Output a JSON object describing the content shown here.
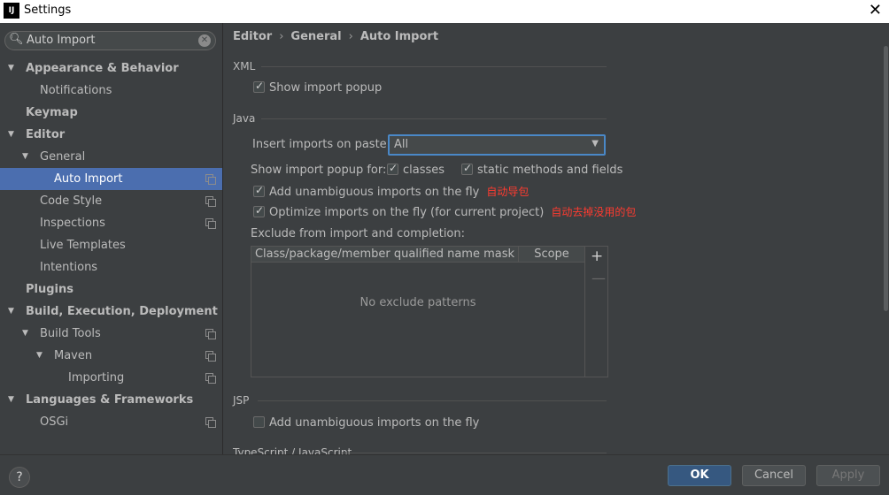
{
  "window": {
    "title": "Settings",
    "icon_text": "IJ",
    "close_icon": "close-icon"
  },
  "search": {
    "value": "Auto Import"
  },
  "tree": [
    {
      "label": "Appearance & Behavior",
      "level": 0,
      "bold": true,
      "expanded": true
    },
    {
      "label": "Notifications",
      "level": 1
    },
    {
      "label": "Keymap",
      "level": 0,
      "bold": true
    },
    {
      "label": "Editor",
      "level": 0,
      "bold": true,
      "expanded": true
    },
    {
      "label": "General",
      "level": 1,
      "expanded": true
    },
    {
      "label": "Auto Import",
      "level": 2,
      "selected": true,
      "config": true
    },
    {
      "label": "Code Style",
      "level": 1,
      "config": true
    },
    {
      "label": "Inspections",
      "level": 1,
      "config": true
    },
    {
      "label": "Live Templates",
      "level": 1
    },
    {
      "label": "Intentions",
      "level": 1
    },
    {
      "label": "Plugins",
      "level": 0,
      "bold": true
    },
    {
      "label": "Build, Execution, Deployment",
      "level": 0,
      "bold": true,
      "expanded": true
    },
    {
      "label": "Build Tools",
      "level": 1,
      "expanded": true,
      "config": true
    },
    {
      "label": "Maven",
      "level": 2,
      "expanded": true,
      "config": true
    },
    {
      "label": "Importing",
      "level": 3,
      "config": true
    },
    {
      "label": "Languages & Frameworks",
      "level": 0,
      "bold": true,
      "expanded": true
    },
    {
      "label": "OSGi",
      "level": 1,
      "config": true
    }
  ],
  "breadcrumb": {
    "items": [
      "Editor",
      "General",
      "Auto Import"
    ],
    "separator": "›"
  },
  "xml": {
    "title": "XML",
    "show_import_popup": {
      "label": "Show import popup",
      "checked": true
    }
  },
  "java": {
    "title": "Java",
    "insert_imports_label": "Insert imports on paste:",
    "insert_imports_value": "All",
    "show_popup_for_label": "Show import popup for:",
    "classes": {
      "label": "classes",
      "checked": true
    },
    "static_methods": {
      "label": "static methods and fields",
      "checked": true
    },
    "add_unambiguous": {
      "label": "Add unambiguous imports on the fly",
      "checked": true,
      "annotation": "自动导包"
    },
    "optimize_imports": {
      "label": "Optimize imports on the fly (for current project)",
      "checked": true,
      "annotation": "自动去掉没用的包"
    },
    "exclude_label": "Exclude from import and completion:",
    "table": {
      "columns": [
        "Class/package/member qualified name mask",
        "Scope"
      ],
      "empty_text": "No exclude patterns",
      "add": "+",
      "remove": "—"
    }
  },
  "jsp": {
    "title": "JSP",
    "add_unambiguous": {
      "label": "Add unambiguous imports on the fly",
      "checked": false
    }
  },
  "typescript": {
    "title": "TypeScript / JavaScript"
  },
  "footer": {
    "help": "?",
    "ok": "OK",
    "cancel": "Cancel",
    "apply": "Apply"
  },
  "colors": {
    "accent": "#4b6eaf",
    "annotation": "#ff3b30",
    "background": "#3c3f41"
  }
}
